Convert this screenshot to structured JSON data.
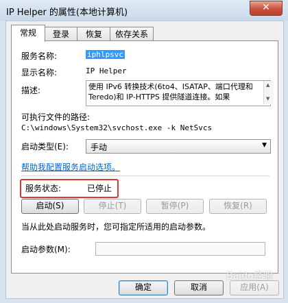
{
  "window": {
    "title": "IP Helper 的属性(本地计算机)",
    "close_glyph": "✕"
  },
  "tabs": [
    {
      "label": "常规",
      "active": true
    },
    {
      "label": "登录",
      "active": false
    },
    {
      "label": "恢复",
      "active": false
    },
    {
      "label": "依存关系",
      "active": false
    }
  ],
  "general": {
    "service_name_label": "服务名称:",
    "service_name_value": "iphlpsvc",
    "display_name_label": "显示名称:",
    "display_name_value": "IP Helper",
    "description_label": "描述:",
    "description_value": "使用 IPv6 转换技术(6to4、ISATAP、端口代理和 Teredo)和 IP-HTTPS 提供隧道连接。如果",
    "exe_path_label": "可执行文件的路径:",
    "exe_path_value": "C:\\windows\\System32\\svchost.exe -k NetSvcs",
    "startup_type_label": "启动类型(E):",
    "startup_type_value": "手动",
    "help_link": "帮助我配置服务启动选项。",
    "status_label": "服务状态:",
    "status_value": "已停止",
    "buttons": {
      "start": "启动(S)",
      "stop": "停止(T)",
      "pause": "暂停(P)",
      "resume": "恢复(R)"
    },
    "hint_text": "当从此处启动服务时，您可指定所适用的启动参数。",
    "start_params_label": "启动参数(M):",
    "start_params_value": ""
  },
  "footer": {
    "ok": "确定",
    "cancel": "取消",
    "apply": "应用(A)"
  },
  "watermark": "Baidu经验",
  "colors": {
    "highlight_box": "#e0342e",
    "link": "#0066cc",
    "selection": "#3399ff"
  }
}
